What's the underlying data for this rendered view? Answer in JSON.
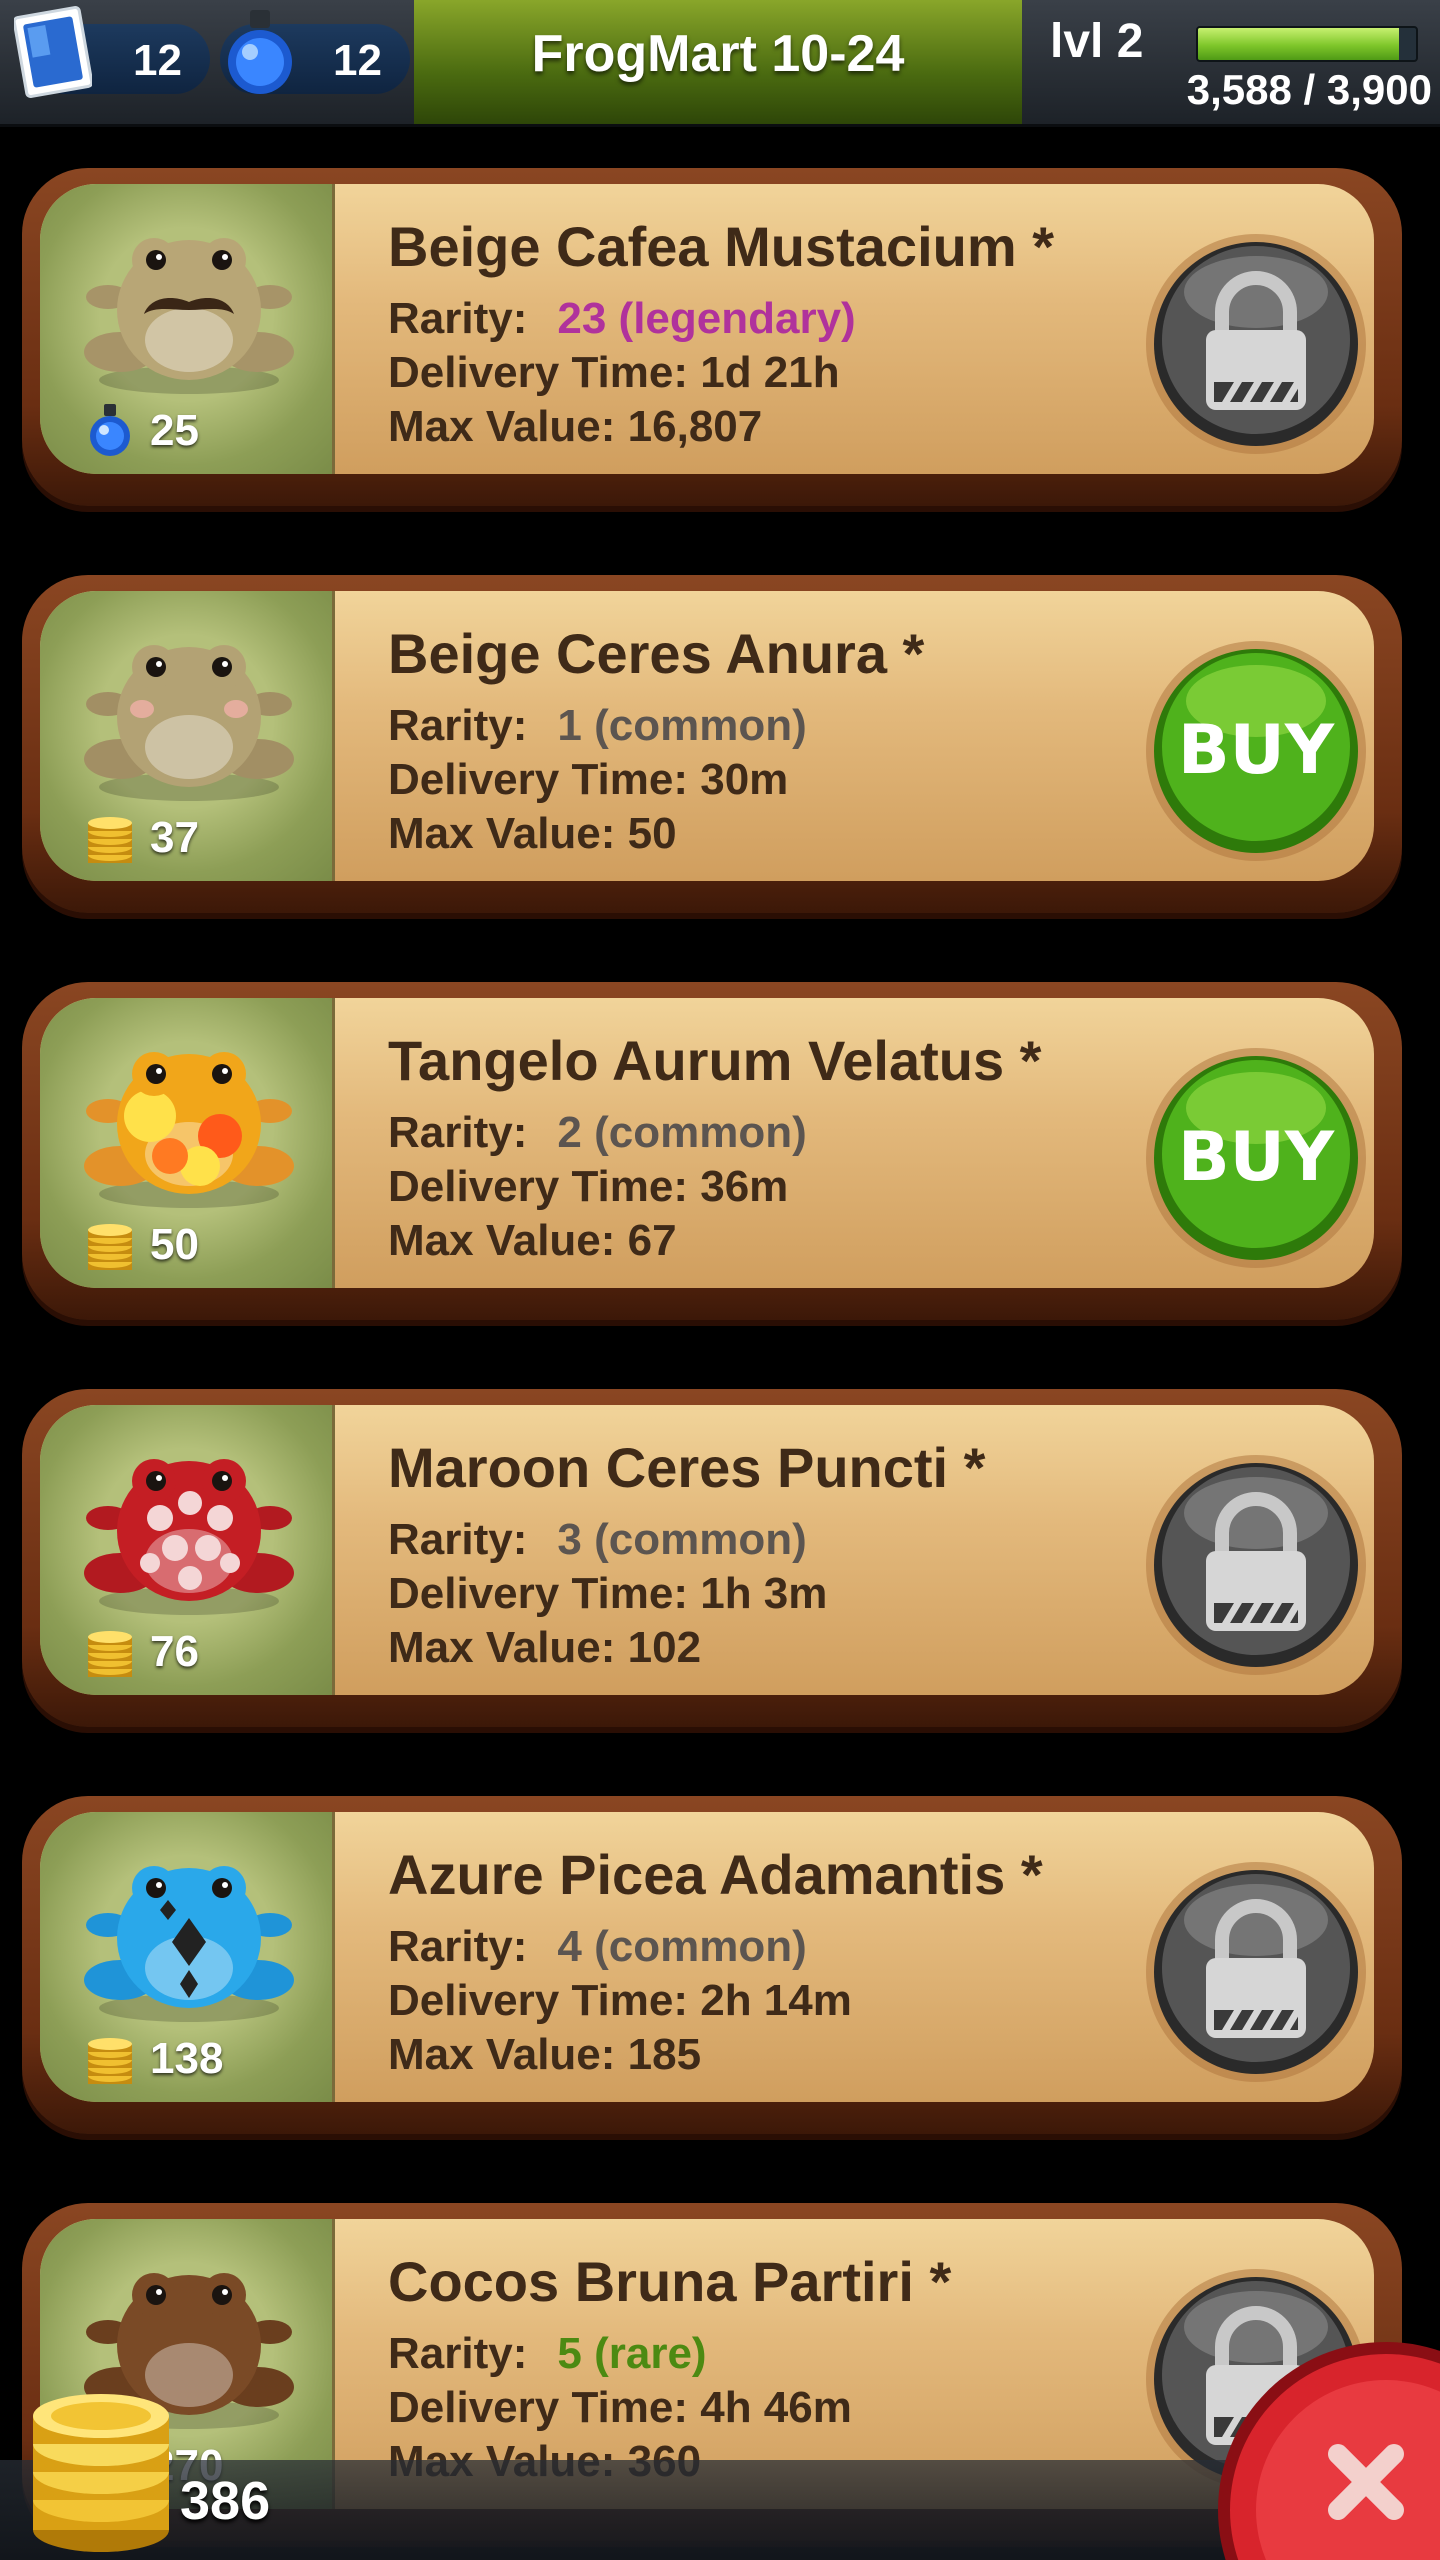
{
  "header": {
    "stamps": "12",
    "potions": "12",
    "title": "FrogMart 10-24",
    "level": "lvl 2",
    "xp_text": "3,588 / 3,900",
    "xp_progress": 0.92
  },
  "colors": {
    "legendary": "#b0329c",
    "common": "#5c5550",
    "rare": "#4c8a12",
    "buy_green": "#4fb21c",
    "card_frame": "#7a3a1a"
  },
  "cards": [
    {
      "name": "Beige Cafea Mustacium *",
      "rarity_label": "Rarity:",
      "rarity": "23 (legendary)",
      "delivery": "Delivery Time: 1d 21h",
      "max_value": "Max Value: 16,807",
      "cost": "25",
      "currency_icon": "potion-icon",
      "action": "lock-icon"
    },
    {
      "name": "Beige Ceres Anura *",
      "rarity_label": "Rarity:",
      "rarity": "1 (common)",
      "delivery": "Delivery Time: 30m",
      "max_value": "Max Value: 50",
      "cost": "37",
      "currency_icon": "coin-icon",
      "action": "BUY"
    },
    {
      "name": "Tangelo Aurum Velatus *",
      "rarity_label": "Rarity:",
      "rarity": "2 (common)",
      "delivery": "Delivery Time: 36m",
      "max_value": "Max Value: 67",
      "cost": "50",
      "currency_icon": "coin-icon",
      "action": "BUY"
    },
    {
      "name": "Maroon Ceres Puncti *",
      "rarity_label": "Rarity:",
      "rarity": "3 (common)",
      "delivery": "Delivery Time: 1h 3m",
      "max_value": "Max Value: 102",
      "cost": "76",
      "currency_icon": "coin-icon",
      "action": "lock-icon"
    },
    {
      "name": "Azure Picea Adamantis *",
      "rarity_label": "Rarity:",
      "rarity": "4 (common)",
      "delivery": "Delivery Time: 2h 14m",
      "max_value": "Max Value: 185",
      "cost": "138",
      "currency_icon": "coin-icon",
      "action": "lock-icon"
    },
    {
      "name": "Cocos Bruna Partiri *",
      "rarity_label": "Rarity:",
      "rarity": "5 (rare)",
      "delivery": "Delivery Time: 4h 46m",
      "max_value": "Max Value: 360",
      "cost": "270",
      "currency_icon": "coin-icon",
      "action": "lock-icon"
    }
  ],
  "footer": {
    "coins": "386",
    "close_icon": "close-icon"
  }
}
